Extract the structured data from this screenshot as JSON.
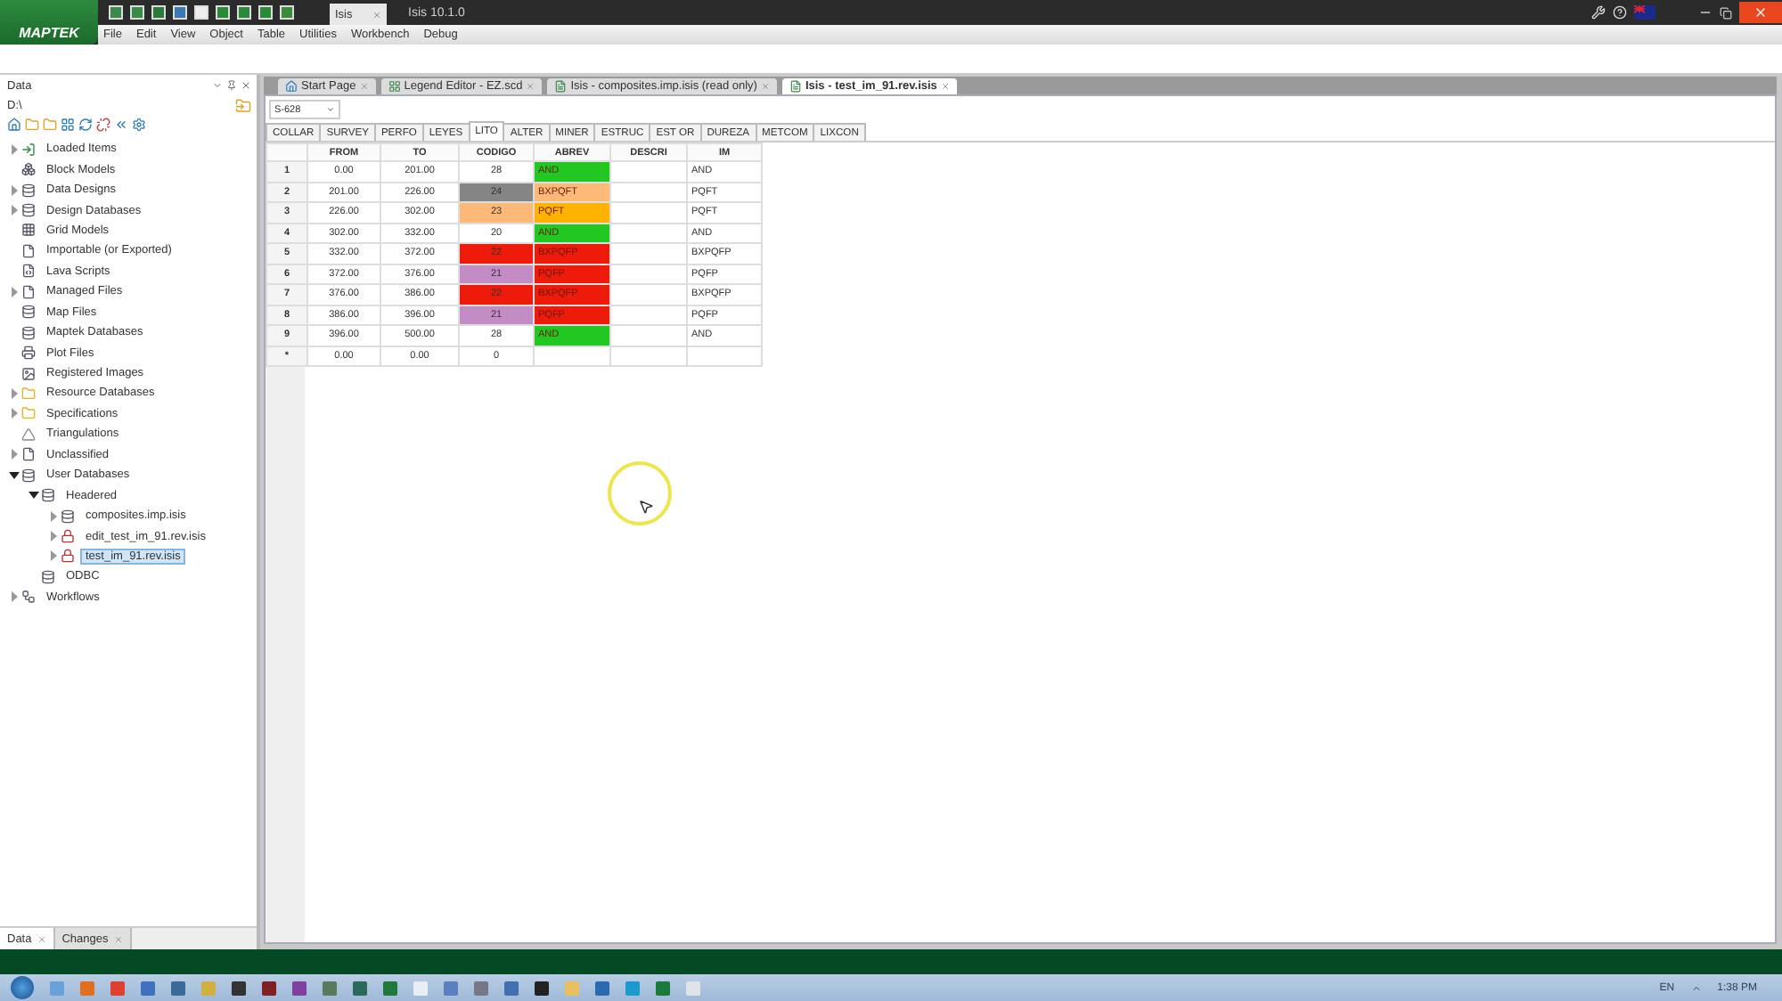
{
  "title_bar": {
    "logo": "MAPTEK",
    "app_tab": "Isis",
    "title": "Isis 10.1.0"
  },
  "menu": [
    "File",
    "Edit",
    "View",
    "Object",
    "Table",
    "Utilities",
    "Workbench",
    "Debug"
  ],
  "data_panel": {
    "title": "Data",
    "path": "D:\\",
    "tree": [
      {
        "label": "Loaded Items",
        "kind": "loaded",
        "expanded": false,
        "selected": false
      },
      {
        "label": "Block Models",
        "kind": "block",
        "selected": false
      },
      {
        "label": "Data Designs",
        "kind": "database",
        "expanded": false,
        "selected": false
      },
      {
        "label": "Design Databases",
        "kind": "database",
        "expanded": false,
        "selected": false
      },
      {
        "label": "Grid Models",
        "kind": "grid",
        "selected": false
      },
      {
        "label": "Importable (or Exported)",
        "kind": "file",
        "selected": false
      },
      {
        "label": "Lava Scripts",
        "kind": "script",
        "selected": false
      },
      {
        "label": "Managed Files",
        "kind": "file",
        "expanded": false,
        "selected": false
      },
      {
        "label": "Map Files",
        "kind": "database",
        "selected": false
      },
      {
        "label": "Maptek Databases",
        "kind": "database",
        "selected": false
      },
      {
        "label": "Plot Files",
        "kind": "plot",
        "selected": false
      },
      {
        "label": "Registered Images",
        "kind": "image",
        "selected": false
      },
      {
        "label": "Resource Databases",
        "kind": "folder",
        "expanded": false,
        "selected": false
      },
      {
        "label": "Specifications",
        "kind": "folder",
        "expanded": false,
        "selected": false
      },
      {
        "label": "Triangulations",
        "kind": "triangle",
        "selected": false
      },
      {
        "label": "Unclassified",
        "kind": "file",
        "expanded": false,
        "selected": false
      },
      {
        "label": "User Databases",
        "kind": "database",
        "expanded": true,
        "selected": false,
        "children": [
          {
            "label": "Headered",
            "kind": "database",
            "expanded": true,
            "selected": false,
            "children": [
              {
                "label": "composites.imp.isis",
                "kind": "database",
                "expanded": false,
                "selected": false
              },
              {
                "label": "edit_test_im_91.rev.isis",
                "kind": "locked",
                "expanded": false,
                "selected": false
              },
              {
                "label": "test_im_91.rev.isis",
                "kind": "locked",
                "expanded": false,
                "selected": true
              }
            ]
          },
          {
            "label": "ODBC",
            "kind": "database",
            "selected": false
          }
        ]
      },
      {
        "label": "Workflows",
        "kind": "workflow",
        "expanded": false,
        "selected": false
      }
    ],
    "bottom_tabs": [
      {
        "label": "Data",
        "selected": true
      },
      {
        "label": "Changes",
        "selected": false
      }
    ]
  },
  "doc_tabs": [
    {
      "label": "Start Page",
      "kind": "home",
      "selected": false
    },
    {
      "label": "Legend Editor - EZ.scd",
      "kind": "legend",
      "selected": false
    },
    {
      "label": "Isis - composites.imp.isis (read only)",
      "kind": "isis",
      "selected": false
    },
    {
      "label": "Isis - test_im_91.rev.isis",
      "kind": "isis",
      "selected": true
    }
  ],
  "hole_selector": "S-628",
  "table_tabs": [
    {
      "label": "COLLAR",
      "selected": false
    },
    {
      "label": "SURVEY",
      "selected": false
    },
    {
      "label": "PERFO",
      "selected": false
    },
    {
      "label": "LEYES",
      "selected": false
    },
    {
      "label": "LITO",
      "selected": true
    },
    {
      "label": "ALTER",
      "selected": false
    },
    {
      "label": "MINER",
      "selected": false
    },
    {
      "label": "ESTRUC",
      "selected": false
    },
    {
      "label": "EST OR",
      "selected": false
    },
    {
      "label": "DUREZA",
      "selected": false
    },
    {
      "label": "METCOM",
      "selected": false
    },
    {
      "label": "LIXCON",
      "selected": false
    }
  ],
  "table": {
    "columns": [
      "FROM",
      "TO",
      "CODIGO",
      "ABREV",
      "DESCRI",
      "IM"
    ],
    "rows": [
      {
        "row": "1",
        "from": "0.00",
        "to": "201.00",
        "codigo": {
          "text": "28"
        },
        "abrev": {
          "text": "AND",
          "color": "#22c722"
        },
        "im": "AND"
      },
      {
        "row": "2",
        "from": "201.00",
        "to": "226.00",
        "codigo": {
          "text": "24",
          "color": "#858585"
        },
        "abrev": {
          "text": "BXPQFT",
          "color": "#fdb978"
        },
        "im": "PQFT"
      },
      {
        "row": "3",
        "from": "226.00",
        "to": "302.00",
        "codigo": {
          "text": "23",
          "color": "#fdb978"
        },
        "abrev": {
          "text": "PQFT",
          "color": "#ffb300"
        },
        "im": "PQFT"
      },
      {
        "row": "4",
        "from": "302.00",
        "to": "332.00",
        "codigo": {
          "text": "20"
        },
        "abrev": {
          "text": "AND",
          "color": "#22c722"
        },
        "im": "AND"
      },
      {
        "row": "5",
        "from": "332.00",
        "to": "372.00",
        "codigo": {
          "text": "22",
          "color": "#ee1a0a"
        },
        "abrev": {
          "text": "BXPQFP",
          "color": "#ee1a0a"
        },
        "im": "BXPQFP"
      },
      {
        "row": "6",
        "from": "372.00",
        "to": "376.00",
        "codigo": {
          "text": "21",
          "color": "#c48cc4"
        },
        "abrev": {
          "text": "PQFP",
          "color": "#ee1a0a"
        },
        "im": "PQFP"
      },
      {
        "row": "7",
        "from": "376.00",
        "to": "386.00",
        "codigo": {
          "text": "22",
          "color": "#ee1a0a"
        },
        "abrev": {
          "text": "BXPQFP",
          "color": "#ee1a0a"
        },
        "im": "BXPQFP"
      },
      {
        "row": "8",
        "from": "386.00",
        "to": "396.00",
        "codigo": {
          "text": "21",
          "color": "#c48cc4"
        },
        "abrev": {
          "text": "PQFP",
          "color": "#ee1a0a"
        },
        "im": "PQFP"
      },
      {
        "row": "9",
        "from": "396.00",
        "to": "500.00",
        "codigo": {
          "text": "28"
        },
        "abrev": {
          "text": "AND",
          "color": "#22c722"
        },
        "im": "AND"
      },
      {
        "row": "*",
        "from": "0.00",
        "to": "0.00",
        "codigo": {
          "text": "0"
        }
      }
    ]
  },
  "taskbar": {
    "language": "EN",
    "clock": "1:38 PM"
  }
}
